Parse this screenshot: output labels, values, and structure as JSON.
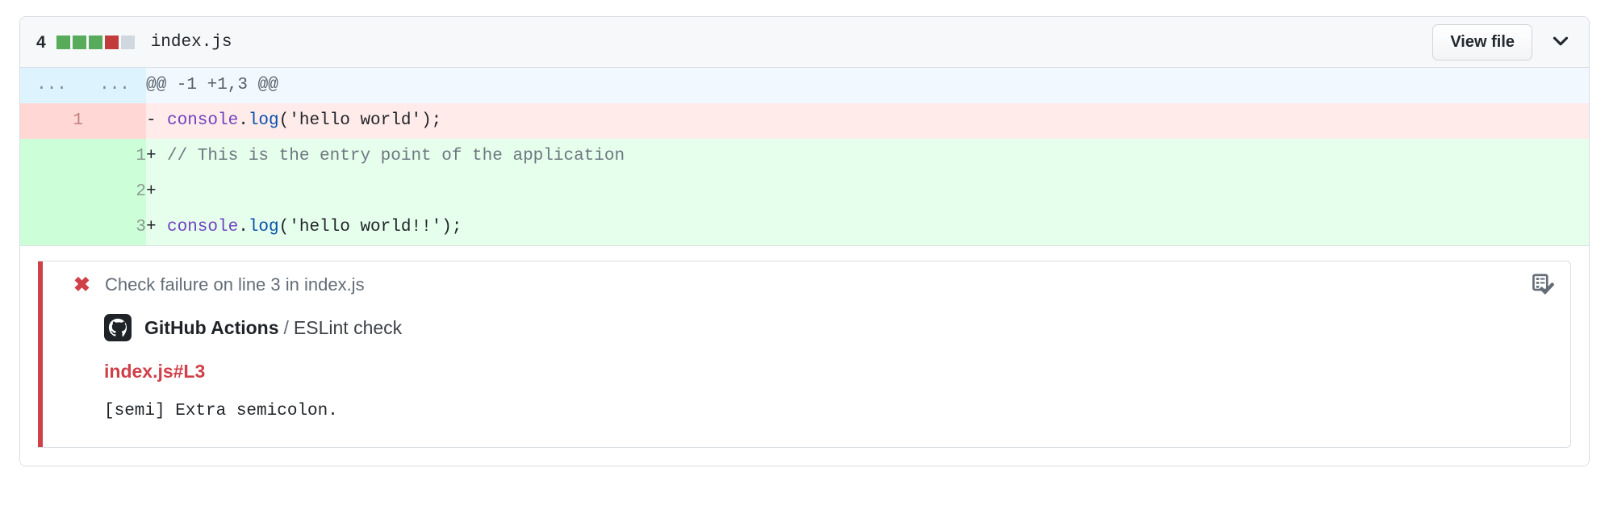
{
  "file": {
    "change_count": "4",
    "name": "index.js",
    "diffstat": {
      "blocks": [
        "added",
        "added",
        "added",
        "deleted",
        "neutral"
      ],
      "added_color": "#57ab5a",
      "deleted_color": "#c23c3c",
      "neutral_color": "#d0d7de"
    },
    "view_file_label": "View file",
    "chevron_icon": "chevron-down-icon"
  },
  "diff": {
    "hunk": {
      "old_gutter": "...",
      "new_gutter": "...",
      "header": "@@ -1 +1,3 @@"
    },
    "rows": [
      {
        "type": "deleted",
        "old_line": "1",
        "new_line": "",
        "marker": "-",
        "tokens": [
          {
            "text": "console",
            "cls": "tok-obj"
          },
          {
            "text": ".",
            "cls": "tok-pun"
          },
          {
            "text": "log",
            "cls": "tok-fn"
          },
          {
            "text": "('hello world');",
            "cls": "tok-str"
          }
        ],
        "plain": "- console.log('hello world');"
      },
      {
        "type": "added",
        "old_line": "",
        "new_line": "1",
        "marker": "+",
        "tokens": [
          {
            "text": "// This is the entry point of the application",
            "cls": "tok-cmt"
          }
        ],
        "plain": "+ // This is the entry point of the application"
      },
      {
        "type": "added",
        "old_line": "",
        "new_line": "2",
        "marker": "+",
        "tokens": [],
        "plain": "+"
      },
      {
        "type": "added",
        "old_line": "",
        "new_line": "3",
        "marker": "+",
        "tokens": [
          {
            "text": "console",
            "cls": "tok-obj"
          },
          {
            "text": ".",
            "cls": "tok-pun"
          },
          {
            "text": "log",
            "cls": "tok-fn"
          },
          {
            "text": "('hello world!!');",
            "cls": "tok-str"
          }
        ],
        "plain": "+ console.log('hello world!!');"
      }
    ]
  },
  "annotation": {
    "status_icon": "x-icon",
    "accent_color": "#cf4048",
    "title": "Check failure on line 3 in index.js",
    "checks_icon": "checklist-check-icon",
    "actor_avatar_icon": "github-octocat-icon",
    "actor_name": "GitHub Actions",
    "separator": "/",
    "check_name": "ESLint check",
    "location_link": "index.js#L3",
    "message": "[semi] Extra semicolon."
  }
}
